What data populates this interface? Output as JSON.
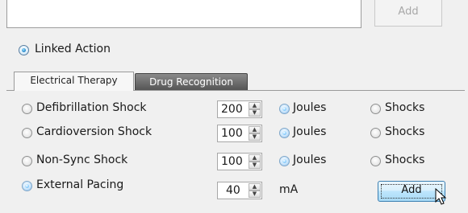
{
  "top": {
    "add_label": "Add"
  },
  "linked_action": {
    "label": "Linked Action",
    "checked": true
  },
  "tabs": [
    {
      "label": "Electrical Therapy",
      "active": true
    },
    {
      "label": "Drug Recognition",
      "active": false
    }
  ],
  "therapy_rows": [
    {
      "name": "Defibrillation Shock",
      "value": "200",
      "unit_joules": "Joules",
      "unit_shocks": "Shocks",
      "selected": false
    },
    {
      "name": "Cardioversion Shock",
      "value": "100",
      "unit_joules": "Joules",
      "unit_shocks": "Shocks",
      "selected": false
    },
    {
      "name": "Non-Sync Shock",
      "value": "100",
      "unit_joules": "Joules",
      "unit_shocks": "Shocks",
      "selected": false
    },
    {
      "name": "External Pacing",
      "value": "40",
      "unit": "mA",
      "selected": true
    }
  ],
  "add_button": {
    "label": "Add"
  },
  "colors": {
    "accent": "#3c7fb1",
    "inactive_tab": "#555555"
  }
}
